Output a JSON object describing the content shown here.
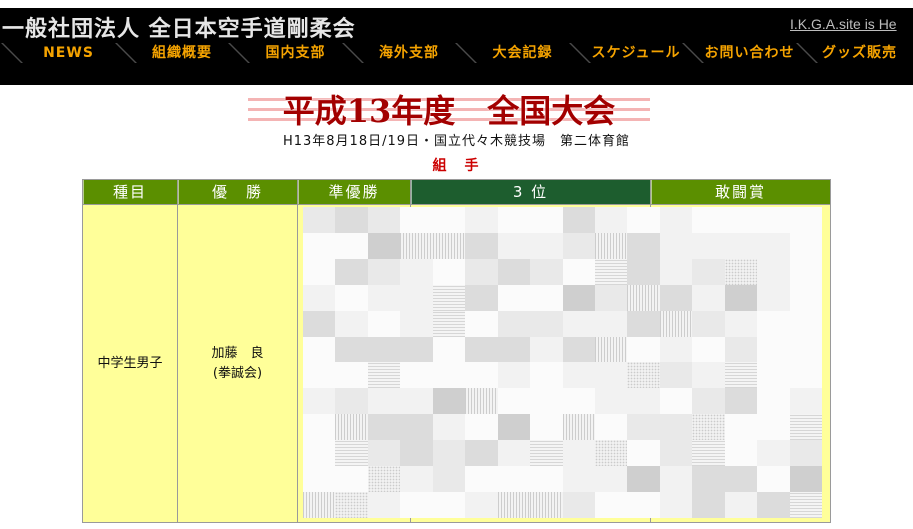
{
  "header": {
    "site_title": "一般社団法人 全日本空手道剛柔会",
    "site_link": "I.K.G.A.site is He"
  },
  "nav": {
    "items": [
      "NEWS",
      "組織概要",
      "国内支部",
      "海外支部",
      "大会記録",
      "スケジュール",
      "お問い合わせ",
      "グッズ販売"
    ]
  },
  "page": {
    "title": "平成13年度　全国大会",
    "subtitle": "H13年8月18日/19日・国立代々木競技場　第二体育館",
    "section": "組　手"
  },
  "table": {
    "headers": [
      "種目",
      "優　勝",
      "準優勝",
      "3 位",
      "敢闘賞"
    ],
    "rows": [
      {
        "event": "中学生男子",
        "winner": {
          "name": "加藤　良",
          "club": "(拳誠会)"
        }
      }
    ]
  },
  "colors": {
    "header_bg": "#000000",
    "site_title": "#e6e6e6",
    "site_link": "#bdbdbd",
    "nav_text": "#f5a300",
    "title": "#a30000",
    "title_stripe": "#f4b4b4",
    "section": "#cc0000",
    "th_green": "#5b8f00",
    "th_dark_green": "#1d5d2e",
    "row_yellow": "#ffff99"
  }
}
